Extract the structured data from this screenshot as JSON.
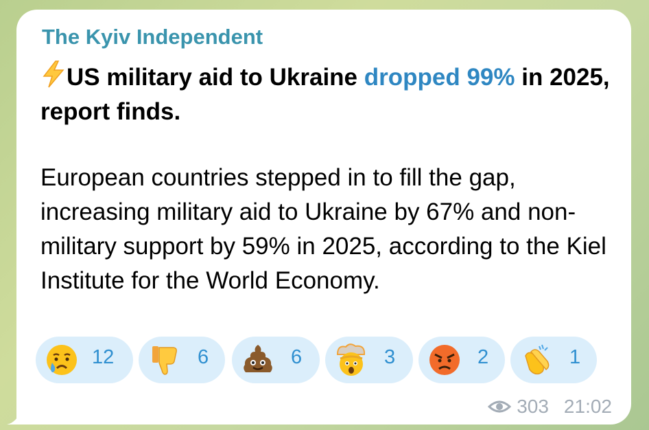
{
  "channel": {
    "name": "The Kyiv Independent"
  },
  "post": {
    "headline_part1": "US military aid to Ukraine ",
    "headline_link": "dropped 99%",
    "headline_part2": " in 2025, report finds.",
    "body": "European countries stepped in to fill the gap, increasing military aid to Ukraine by 67% and non-military support by 59% in 2025, according to the Kiel Institute for the World Economy."
  },
  "reactions": [
    {
      "icon": "crying-face-icon",
      "count": "12"
    },
    {
      "icon": "thumbs-down-icon",
      "count": "6"
    },
    {
      "icon": "pile-of-poo-icon",
      "count": "6"
    },
    {
      "icon": "exploding-head-icon",
      "count": "3"
    },
    {
      "icon": "angry-face-icon",
      "count": "2"
    },
    {
      "icon": "clapping-hands-icon",
      "count": "1"
    }
  ],
  "meta": {
    "views": "303",
    "time": "21:02"
  },
  "colors": {
    "channel": "#3a94ad",
    "link": "#2f87c2",
    "reaction_bg": "#dbeefb",
    "reaction_text": "#2f8fd0",
    "meta_text": "#a3acb6"
  }
}
